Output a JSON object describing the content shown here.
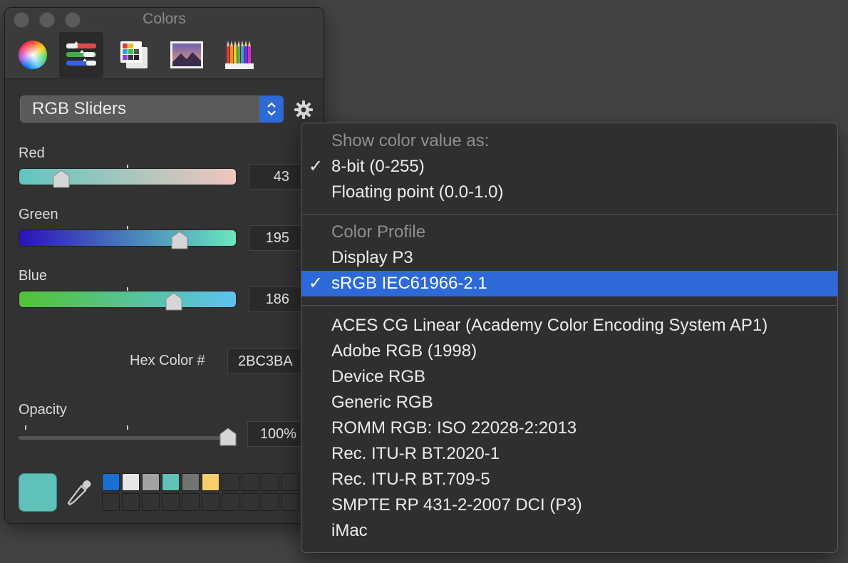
{
  "window": {
    "title": "Colors",
    "toolbar": [
      {
        "icon": "color-wheel-icon"
      },
      {
        "icon": "color-sliders-icon",
        "active": true
      },
      {
        "icon": "color-palettes-icon"
      },
      {
        "icon": "image-palettes-icon"
      },
      {
        "icon": "pencils-icon"
      }
    ],
    "mode_label": "RGB Sliders",
    "sliders": [
      {
        "label": "Red",
        "value": "43",
        "fraction": 0.17
      },
      {
        "label": "Green",
        "value": "195",
        "fraction": 0.76
      },
      {
        "label": "Blue",
        "value": "186",
        "fraction": 0.73
      }
    ],
    "hex_label": "Hex Color #",
    "hex_value": "2BC3BA",
    "opacity_label": "Opacity",
    "opacity_value": "100%",
    "opacity_fraction": 1.0,
    "current_color": "#5fc1b8",
    "swatches": [
      "#1a6fd0",
      "#e6e6e6",
      "#a2a2a2",
      "#5fc1b8",
      "#737373",
      "#f6cf6a"
    ]
  },
  "menu": {
    "value_header": "Show color value as:",
    "value_items": [
      {
        "label": "8-bit (0-255)",
        "checked": true
      },
      {
        "label": "Floating point (0.0-1.0)",
        "checked": false
      }
    ],
    "profile_header": "Color Profile",
    "profile_items": [
      {
        "label": "Display P3",
        "checked": false
      },
      {
        "label": "sRGB IEC61966-2.1",
        "checked": true,
        "selected": true
      }
    ],
    "other_profiles": [
      "ACES CG Linear (Academy Color Encoding System AP1)",
      "Adobe RGB (1998)",
      "Device RGB",
      "Generic RGB",
      "ROMM RGB: ISO 22028-2:2013",
      "Rec. ITU-R BT.2020-1",
      "Rec. ITU-R BT.709-5",
      "SMPTE RP 431-2-2007 DCI (P3)",
      "iMac"
    ],
    "checkmark": "✓"
  }
}
